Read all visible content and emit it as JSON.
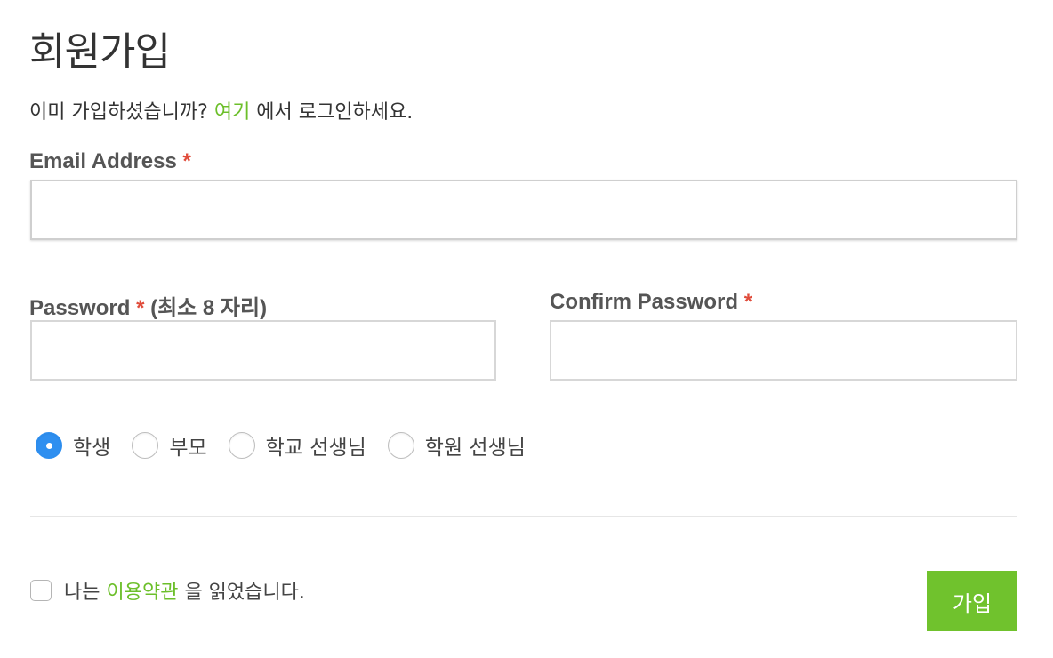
{
  "page": {
    "title": "회원가입"
  },
  "login_prompt": {
    "before": "이미 가입하셨습니까? ",
    "link": "여기",
    "after": " 에서 로그인하세요."
  },
  "fields": {
    "email": {
      "label": "Email Address",
      "required_mark": "*",
      "value": ""
    },
    "password": {
      "label": "Password",
      "required_mark": "*",
      "hint": " (최소 8 자리)",
      "value": ""
    },
    "confirm_password": {
      "label": "Confirm Password",
      "required_mark": "*",
      "value": ""
    }
  },
  "roles": [
    {
      "label": "학생",
      "checked": true
    },
    {
      "label": "부모",
      "checked": false
    },
    {
      "label": "학교 선생님",
      "checked": false
    },
    {
      "label": "학원 선생님",
      "checked": false
    }
  ],
  "terms": {
    "before": "나는 ",
    "link": "이용약관",
    "after": " 을 읽었습니다.",
    "checked": false
  },
  "submit_label": "가입",
  "colors": {
    "accent_green": "#70c22d",
    "link_green": "#6cbf2a",
    "required_red": "#e04c3b",
    "radio_blue": "#2e8ff0"
  }
}
